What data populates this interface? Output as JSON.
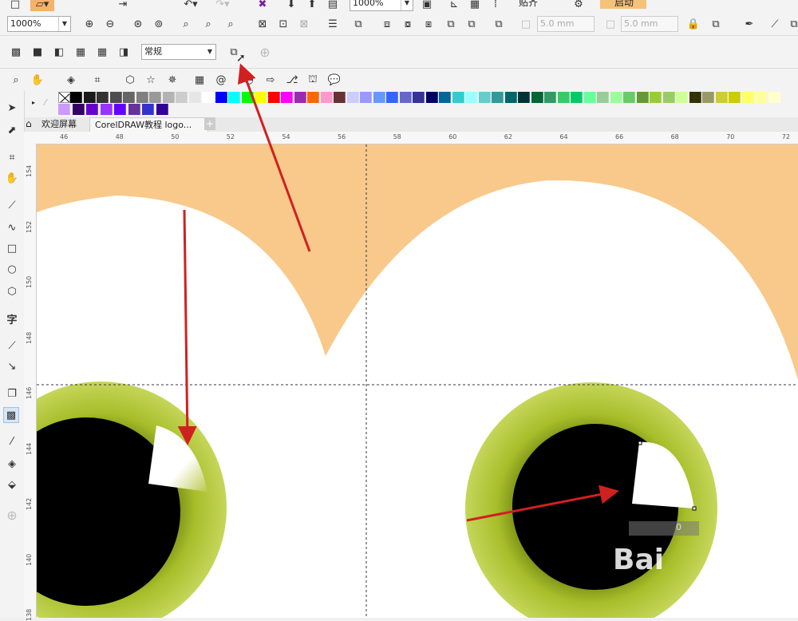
{
  "toolbar_top": {
    "zoom_top_partial": "1000%",
    "snap_label_partial": "贴齐",
    "launch_label_partial": "启动"
  },
  "property_bar": {
    "zoom_value": "1000%",
    "width_value": "5.0 mm",
    "height_value": "5.0 mm"
  },
  "transparency_bar": {
    "merge_mode_value": "常规"
  },
  "doc_tabs": {
    "welcome_tab": "欢迎屏幕",
    "doc_tab": "CorelDRAW教程 logo..."
  },
  "ruler": {
    "h_ticks": [
      "46",
      "48",
      "50",
      "52",
      "54",
      "56",
      "58",
      "60",
      "62",
      "64",
      "66",
      "68",
      "70",
      "72"
    ],
    "v_ticks": [
      "154",
      "152",
      "150",
      "148",
      "146",
      "144",
      "142",
      "140",
      "138"
    ]
  },
  "palette": {
    "row1": [
      "#000000",
      "#1a1a1a",
      "#333333",
      "#4d4d4d",
      "#666666",
      "#808080",
      "#999999",
      "#b3b3b3",
      "#cccccc",
      "#e6e6e6",
      "#ffffff",
      "#0000ff",
      "#00ffff",
      "#00ff00",
      "#ffff00",
      "#ff0000",
      "#ff00ff",
      "#9c2ab0",
      "#ff6600",
      "#ff99cc",
      "#663333",
      "#ccccff",
      "#9999ff",
      "#6699ff",
      "#3366ff",
      "#6666cc",
      "#333399",
      "#000066",
      "#006699",
      "#33cccc",
      "#99ffff",
      "#66cccc",
      "#339999",
      "#006666",
      "#003333",
      "#006633",
      "#339966",
      "#33cc66",
      "#00cc66",
      "#66ff99",
      "#99cc99",
      "#99ff99",
      "#66cc66",
      "#669933",
      "#99cc33",
      "#99cc66",
      "#ccff99",
      "#333300",
      "#999966",
      "#cccc33",
      "#cccc00",
      "#ffff66",
      "#ffff99",
      "#ffffcc"
    ],
    "row2": [
      "#cc99ff",
      "#330066",
      "#6600cc",
      "#9933ff",
      "#6600ff",
      "#663399",
      "#3333cc",
      "#330099"
    ]
  },
  "canvas": {
    "dimension_readout": "0",
    "watermark": "Bai"
  }
}
